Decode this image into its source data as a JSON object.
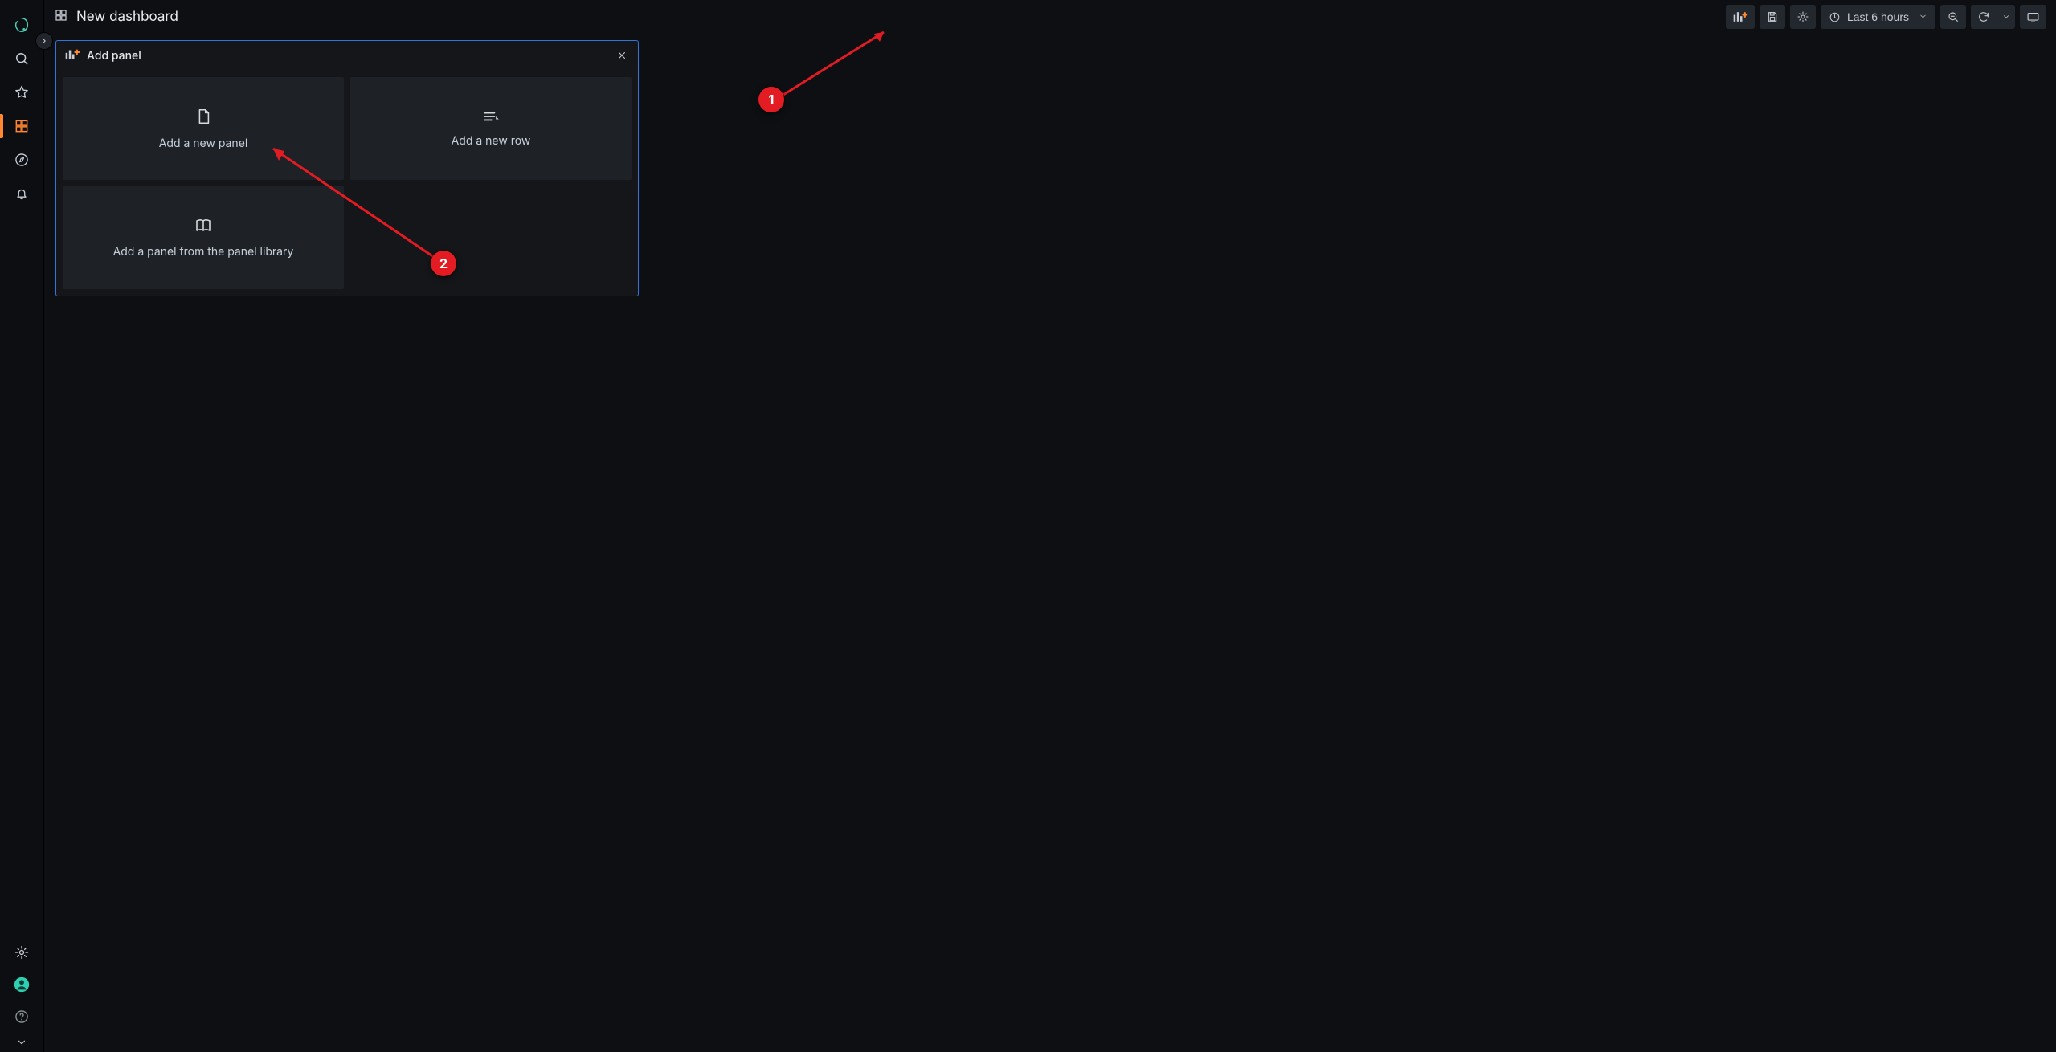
{
  "header": {
    "title": "New dashboard"
  },
  "toolbar": {
    "time_label": "Last 6 hours"
  },
  "sidebar": {
    "active_index": 3
  },
  "add_panel_card": {
    "title": "Add panel",
    "tiles": {
      "new_panel": "Add a new panel",
      "new_row": "Add a new row",
      "library": "Add a panel from the panel library"
    }
  },
  "annotations": {
    "one": "1",
    "two": "2"
  },
  "colors": {
    "accent_orange": "#ff8831",
    "frame_blue": "#3274d9",
    "annotation_red": "#e31b23"
  }
}
